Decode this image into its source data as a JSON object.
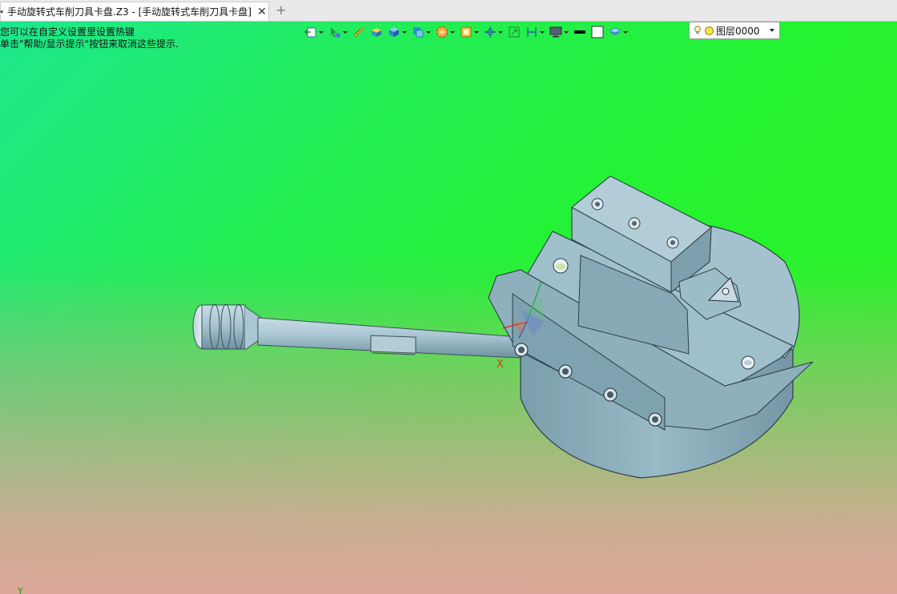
{
  "tab": {
    "title": "手动旋转式车削刀具卡盘.Z3 - [手动旋转式车削刀具卡盘]",
    "close_icon": "close-icon",
    "add_icon": "plus-icon"
  },
  "hints": {
    "line1": "您可以在自定义设置里设置热键",
    "line2": "单击\"帮助/显示提示\"按钮来取消这些提示."
  },
  "toolbar": {
    "buttons": [
      "exit-sketch-icon",
      "pick-filter-icon",
      "ruler-icon",
      "shaded-box-icon",
      "view-cube-icon",
      "section-view-icon",
      "render-icon",
      "display-mode-icon",
      "axis-icon",
      "zoom-fit-icon",
      "align-icon",
      "monitor-icon",
      "black-color-swatch",
      "white-color-swatch",
      "layer-manager-icon"
    ],
    "layer": {
      "name": "图层0000",
      "bulb_icon": "bulb-icon",
      "color": "#f3e24a"
    }
  },
  "viewport": {
    "axis_x": "X",
    "axis_y_corner": "Y",
    "colors": {
      "gradient_top": "#1de88e",
      "gradient_mid": "#25f232",
      "gradient_bottom": "#dca99a",
      "model": "#8fb3c0"
    }
  }
}
